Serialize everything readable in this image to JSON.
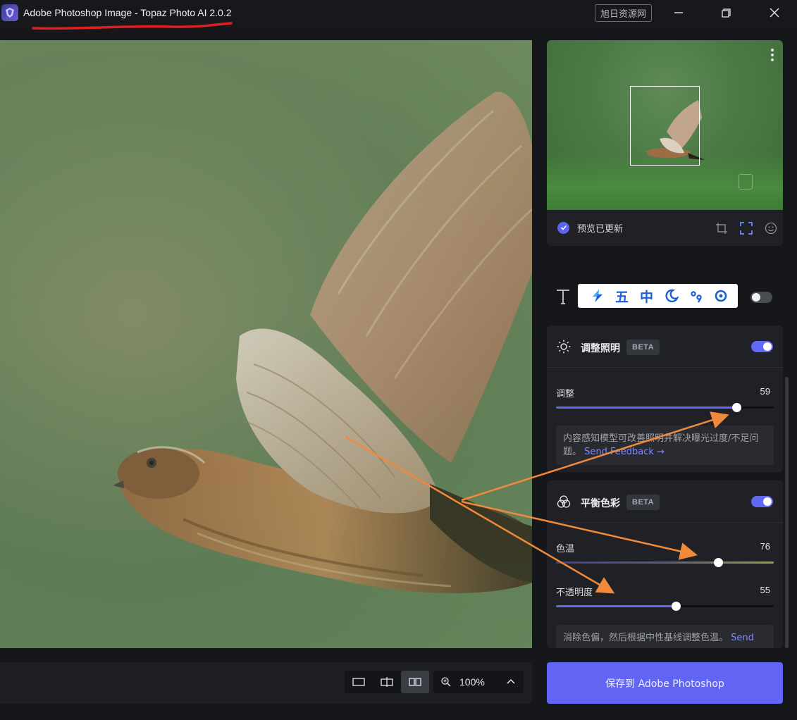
{
  "window": {
    "title": "Adobe Photoshop Image - Topaz Photo AI 2.0.2",
    "watermark_badge": "旭日资源网"
  },
  "navigator": {
    "status": "预览已更新"
  },
  "ime_toolbar": {
    "items": [
      "五",
      "中"
    ]
  },
  "lighting": {
    "title": "调整照明",
    "badge": "BETA",
    "enabled": true,
    "slider_label": "调整",
    "slider_value": "59",
    "slider_fraction": 0.83,
    "info_text": "内容感知模型可改善照明并解决曝光过度/不足问题。",
    "info_link": "Send Feedback →"
  },
  "color_balance": {
    "title": "平衡色彩",
    "badge": "BETA",
    "enabled": true,
    "temp_label": "色温",
    "temp_value": "76",
    "temp_fraction": 0.745,
    "opacity_label": "不透明度",
    "opacity_value": "55",
    "opacity_fraction": 0.55,
    "info_text": "消除色偏，然后根据中性基线调整色温。",
    "info_link": "Send"
  },
  "bottom_toolbar": {
    "zoom": "100%"
  },
  "save_button": "保存到 Adobe Photoshop",
  "colors": {
    "accent": "#6264f4",
    "annotation_arrow": "#f08a3a",
    "underline": "#e02020"
  }
}
